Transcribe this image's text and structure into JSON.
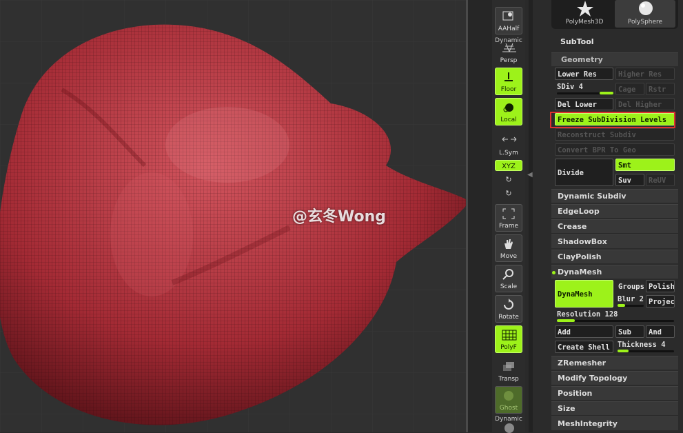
{
  "watermark": "@玄冬Wong",
  "tools": [
    {
      "label": "PolyMesh3D",
      "icon": "star-icon"
    },
    {
      "label": "PolySphere",
      "icon": "sphere-icon"
    }
  ],
  "subtool_title": "SubTool",
  "shelf": {
    "aahalf": "AAHalf",
    "dynamic_top": "Dynamic",
    "persp": "Persp",
    "floor": "Floor",
    "local": "Local",
    "lsym": "L.Sym",
    "xyz": "XYZ",
    "frame": "Frame",
    "move": "Move",
    "scale": "Scale",
    "rotate": "Rotate",
    "polyf": "PolyF",
    "transp": "Transp",
    "ghost": "Ghost",
    "dynamic_bottom": "Dynamic"
  },
  "geometry": {
    "header": "Geometry",
    "lower_res": "Lower Res",
    "higher_res": "Higher Res",
    "sdiv_label": "SDiv 4",
    "sdiv_value": 1.0,
    "cage": "Cage",
    "rstr": "Rstr",
    "del_lower": "Del Lower",
    "del_higher": "Del Higher",
    "freeze": "Freeze SubDivision Levels",
    "reconstruct": "Reconstruct Subdiv",
    "convert_bpr": "Convert BPR To Geo",
    "divide": "Divide",
    "smt": "Smt",
    "suv": "Suv",
    "reuv": "ReUV"
  },
  "subsections": {
    "dynamic_subdiv": "Dynamic Subdiv",
    "edgeloop": "EdgeLoop",
    "crease": "Crease",
    "shadowbox": "ShadowBox",
    "claypolish": "ClayPolish",
    "dynamesh": "DynaMesh"
  },
  "dynamesh": {
    "button": "DynaMesh",
    "groups": "Groups",
    "polish": "Polish",
    "blur": "Blur 2",
    "blur_value": 0.3,
    "project": "Projec",
    "resolution": "Resolution 128",
    "resolution_value": 0.15,
    "add": "Add",
    "sub": "Sub",
    "and": "And",
    "create_shell": "Create Shell",
    "thickness": "Thickness 4",
    "thickness_value": 0.2
  },
  "bottom_sections": {
    "zremesher": "ZRemesher",
    "modify_topology": "Modify Topology",
    "position": "Position",
    "size": "Size",
    "meshintegrity": "MeshIntegrity"
  },
  "colors": {
    "accent": "#9df21a",
    "mesh": "#b8343d",
    "highlight": "#e03030"
  }
}
